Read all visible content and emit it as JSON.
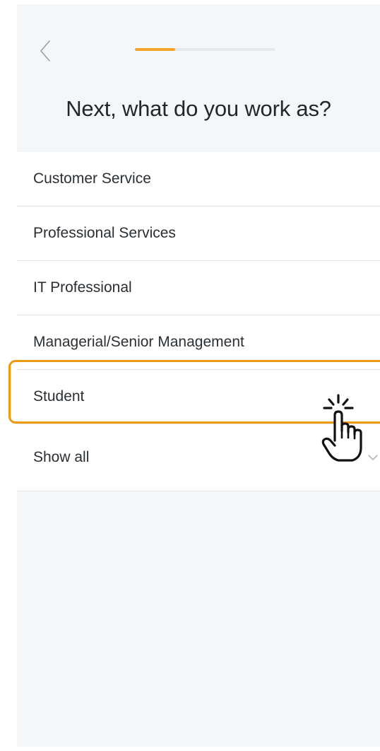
{
  "header": {
    "back_icon": "chevron-left-icon",
    "progress_fraction": 0.29,
    "progress_color": "#f4a62a",
    "title": "Next, what do you work as?"
  },
  "occupations": [
    {
      "label": "Customer Service"
    },
    {
      "label": "Professional Services"
    },
    {
      "label": "IT Professional"
    },
    {
      "label": "Managerial/Senior Management"
    },
    {
      "label": "Student"
    }
  ],
  "show_all": {
    "label": "Show all",
    "icon": "chevron-down-icon"
  },
  "overlay": {
    "highlight_color": "#ec9b10",
    "highlighted_item": "Student",
    "pointer_icon": "tap-hand-icon"
  }
}
